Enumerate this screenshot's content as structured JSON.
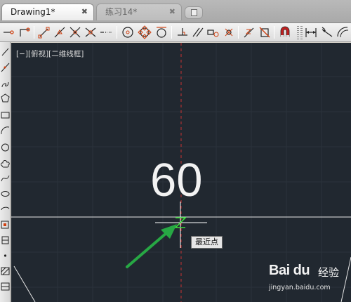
{
  "tabs": [
    {
      "label": "Drawing1*",
      "close": "✖",
      "active": true
    },
    {
      "label": "练习14*",
      "close": "✖",
      "active": false
    }
  ],
  "toolbar": {
    "buttons": [
      "temporary-track-point",
      "snap-from",
      "snap-endpoint",
      "snap-midpoint",
      "snap-intersection",
      "snap-apparent-intersection",
      "snap-extension",
      "snap-center",
      "snap-quadrant",
      "snap-tangent",
      "snap-perpendicular",
      "snap-parallel",
      "snap-insert",
      "snap-node",
      "snap-nearest",
      "snap-none",
      "snap-settings",
      "linear-dimension",
      "aligned-dimension",
      "arc-length-dimension"
    ]
  },
  "left_toolbar": {
    "buttons": [
      "line",
      "construction-line",
      "polyline",
      "polygon",
      "rectangle",
      "arc",
      "circle",
      "revision-cloud",
      "spline",
      "ellipse",
      "ellipse-arc",
      "insert-block",
      "make-block",
      "point",
      "hatch",
      "gradient",
      "region",
      "table",
      "multiline-text"
    ]
  },
  "canvas": {
    "viewport_label": "[−][俯视][二维线框]",
    "dimension_text": "60",
    "snap_tooltip": "最近点",
    "colors": {
      "background": "#212830",
      "crosshair": "#ffffff",
      "center_line": "#d23030",
      "snap_marker": "#3cdc3c",
      "arrow": "#27a844"
    }
  },
  "watermark": {
    "brand": "Bai du",
    "label": "经验",
    "url": "jingyan.baidu.com"
  }
}
